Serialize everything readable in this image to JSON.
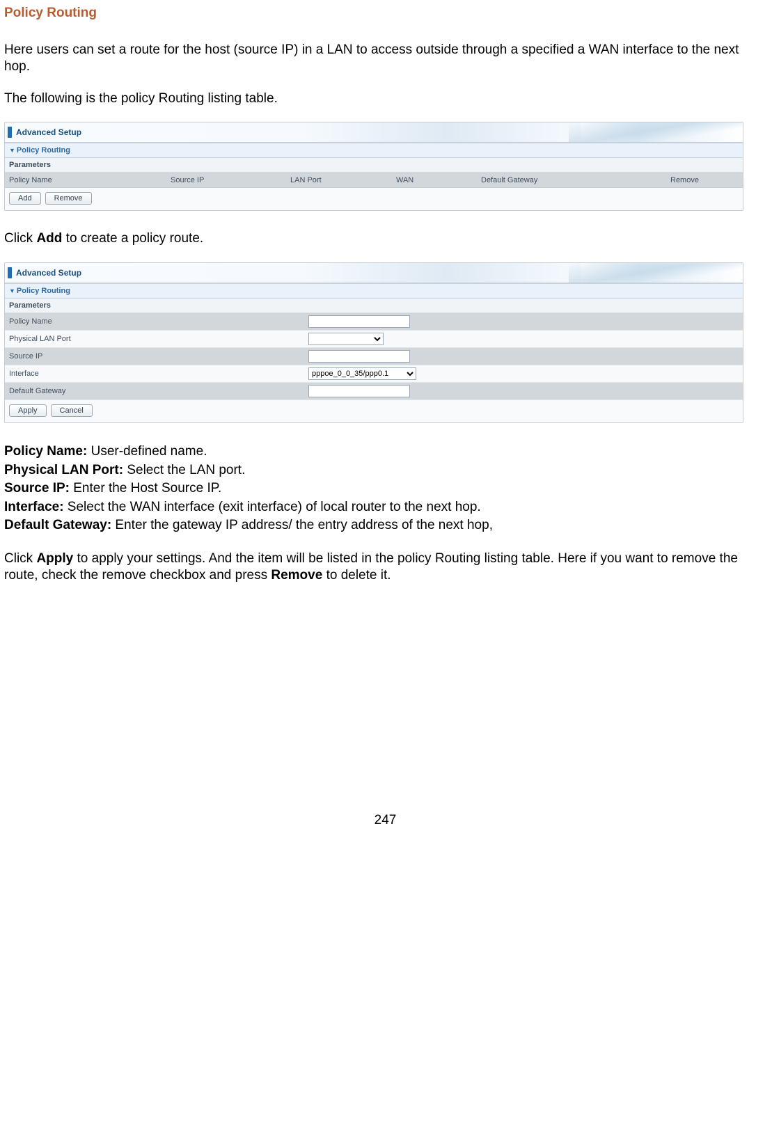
{
  "title": "Policy Routing",
  "intro_para": "Here users can set a route for the host (source IP) in a LAN to access outside through a specified a WAN interface to the next hop.",
  "listing_para": "The following is the policy Routing listing table.",
  "click_add_pre": "Click ",
  "click_add_bold": "Add",
  "click_add_post": " to create a policy route.",
  "panel_header": "Advanced Setup",
  "section_label": "Policy Routing",
  "params_label": "Parameters",
  "table_columns": {
    "policy_name": "Policy Name",
    "source_ip": "Source IP",
    "lan_port": "LAN Port",
    "wan": "WAN",
    "default_gateway": "Default Gateway",
    "remove": "Remove"
  },
  "buttons": {
    "add": "Add",
    "remove": "Remove",
    "apply": "Apply",
    "cancel": "Cancel"
  },
  "form_rows": {
    "policy_name": "Policy Name",
    "physical_lan_port": "Physical LAN Port",
    "source_ip": "Source IP",
    "interface": "Interface",
    "default_gateway": "Default Gateway"
  },
  "interface_selected": "pppoe_0_0_35/ppp0.1",
  "desc": {
    "policy_name_label": "Policy Name:",
    "policy_name_text": " User-defined name.",
    "physical_lan_port_label": "Physical LAN Port:",
    "physical_lan_port_text": " Select the LAN port.",
    "source_ip_label": "Source IP:",
    "source_ip_text": " Enter the Host Source IP.",
    "interface_label": "Interface:",
    "interface_text": " Select the WAN interface (exit interface) of local router to the next hop.",
    "default_gateway_label": "Default Gateway:",
    "default_gateway_text": " Enter the gateway IP address/ the entry address of the next hop,"
  },
  "apply_para_1": "Click ",
  "apply_bold1": "Apply",
  "apply_para_2": " to apply your settings. And the item will be listed in the policy Routing listing table. Here if you want to remove the route, check the remove checkbox and press ",
  "apply_bold2": "Remove",
  "apply_para_3": " to delete it.",
  "page_number": "247"
}
